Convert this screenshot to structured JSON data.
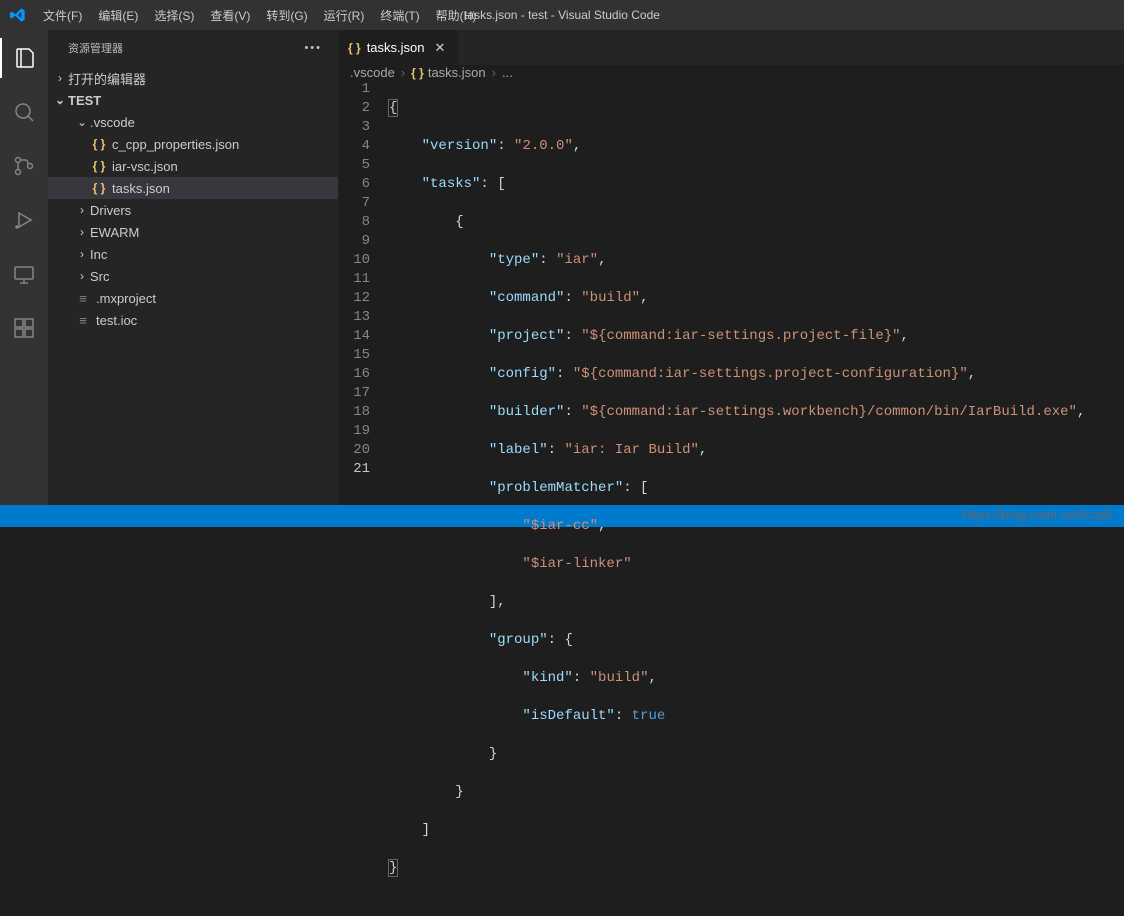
{
  "titlebar": {
    "title": "tasks.json - test - Visual Studio Code",
    "menu": [
      "文件(F)",
      "编辑(E)",
      "选择(S)",
      "查看(V)",
      "转到(G)",
      "运行(R)",
      "终端(T)",
      "帮助(H)"
    ]
  },
  "sidebar": {
    "header": "资源管理器",
    "sections": {
      "open_editors": "打开的编辑器",
      "workspace": "TEST"
    },
    "tree": [
      {
        "label": ".vscode",
        "type": "folder",
        "indent": 2,
        "expanded": true
      },
      {
        "label": "c_cpp_properties.json",
        "type": "json",
        "indent": 3
      },
      {
        "label": "iar-vsc.json",
        "type": "json",
        "indent": 3
      },
      {
        "label": "tasks.json",
        "type": "json",
        "indent": 3,
        "selected": true
      },
      {
        "label": "Drivers",
        "type": "folder",
        "indent": 2,
        "expanded": false
      },
      {
        "label": "EWARM",
        "type": "folder",
        "indent": 2,
        "expanded": false
      },
      {
        "label": "Inc",
        "type": "folder",
        "indent": 2,
        "expanded": false
      },
      {
        "label": "Src",
        "type": "folder",
        "indent": 2,
        "expanded": false
      },
      {
        "label": ".mxproject",
        "type": "file",
        "indent": 2
      },
      {
        "label": "test.ioc",
        "type": "file",
        "indent": 2
      }
    ]
  },
  "tabs": [
    {
      "label": "tasks.json",
      "icon": "json",
      "active": true
    }
  ],
  "breadcrumbs": [
    {
      "label": ".vscode",
      "icon": null
    },
    {
      "label": "tasks.json",
      "icon": "json"
    },
    {
      "label": "...",
      "icon": null
    }
  ],
  "code": {
    "version_key": "\"version\"",
    "version_val": "\"2.0.0\"",
    "tasks_key": "\"tasks\"",
    "type_key": "\"type\"",
    "type_val": "\"iar\"",
    "command_key": "\"command\"",
    "command_val": "\"build\"",
    "project_key": "\"project\"",
    "project_val": "\"${command:iar-settings.project-file}\"",
    "config_key": "\"config\"",
    "config_val": "\"${command:iar-settings.project-configuration}\"",
    "builder_key": "\"builder\"",
    "builder_val": "\"${command:iar-settings.workbench}/common/bin/IarBuild.exe\"",
    "label_key": "\"label\"",
    "label_val": "\"iar: Iar Build\"",
    "pm_key": "\"problemMatcher\"",
    "pm_v1": "\"$iar-cc\"",
    "pm_v2": "\"$iar-linker\"",
    "group_key": "\"group\"",
    "kind_key": "\"kind\"",
    "kind_val": "\"build\"",
    "isdef_key": "\"isDefault\"",
    "isdef_val": "true"
  },
  "line_count": 21,
  "active_line": 21,
  "watermark": "https://blog.csdn.net/lczdk"
}
